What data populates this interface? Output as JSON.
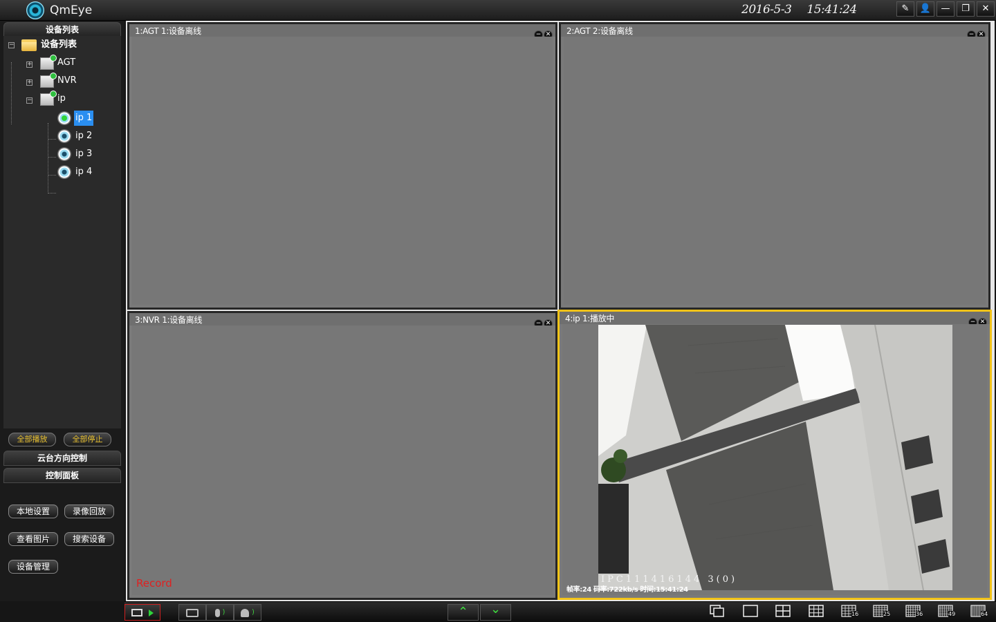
{
  "app": {
    "title": "QmEye"
  },
  "clock": {
    "date": "2016-5-3",
    "time": "15:41:24"
  },
  "window_buttons": [
    "✎",
    "👤",
    "—",
    "❐",
    "✕"
  ],
  "sidebar": {
    "device_list_header": "设备列表",
    "tree": {
      "root": "设备列表",
      "nodes": [
        {
          "label": "AGT",
          "expander": "+"
        },
        {
          "label": "NVR",
          "expander": "+"
        },
        {
          "label": "ip",
          "expander": "−"
        }
      ],
      "channels": [
        {
          "label": "ip 1",
          "selected": true,
          "active": true
        },
        {
          "label": "ip 2",
          "selected": false,
          "active": false
        },
        {
          "label": "ip 3",
          "selected": false,
          "active": false
        },
        {
          "label": "ip 4",
          "selected": false,
          "active": false
        }
      ]
    },
    "play_all": "全部播放",
    "stop_all": "全部停止",
    "ptz_header": "云台方向控制",
    "control_header": "控制面板",
    "buttons": {
      "local_settings": "本地设置",
      "playback": "录像回放",
      "view_images": "查看图片",
      "search_devices": "搜索设备",
      "device_management": "设备管理"
    }
  },
  "panels": [
    {
      "title": "1:AGT 1:设备离线",
      "active": false
    },
    {
      "title": "2:AGT 2:设备离线",
      "active": false
    },
    {
      "title": "3:NVR 1:设备离线",
      "active": false,
      "record_label": "Record"
    },
    {
      "title": "4:ip 1:播放中",
      "active": true,
      "overlay_text": "IPC111416144 3(0)",
      "stats": "帧率:24 码率:722kb/s 时间:15:41:24"
    }
  ],
  "panel_controls": {
    "minimize": "−",
    "close": "✕"
  },
  "bottombar": {
    "up_icon": "⌃",
    "down_icon": "⌄",
    "layouts": [
      "",
      "",
      "",
      "",
      "16",
      "25",
      "36",
      "49",
      "64"
    ]
  },
  "colors": {
    "active_border": "#f2c318",
    "selected": "#2a8ef0",
    "record": "#e02020",
    "gold_text": "#e8c030"
  }
}
